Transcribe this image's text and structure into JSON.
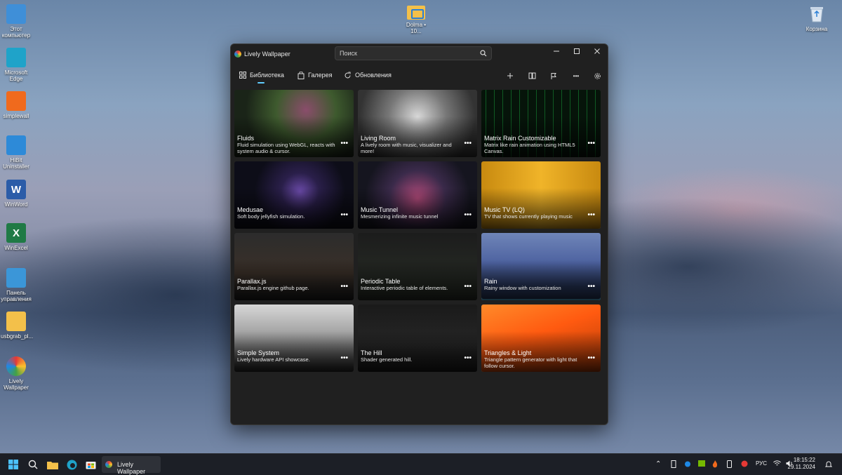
{
  "desktop": {
    "icons": [
      {
        "label": "Этот компьютер",
        "icon": "computer-icon",
        "color": "#3f8fd8"
      },
      {
        "label": "Microsoft Edge",
        "icon": "edge-icon",
        "color": "#1fa3c9"
      },
      {
        "label": "simplewall",
        "icon": "fire-icon",
        "color": "#f06a1d"
      },
      {
        "label": "HiBit Uninstaller",
        "icon": "uninstaller-icon",
        "color": "#2d8ad8"
      },
      {
        "label": "WinWord",
        "icon": "word-icon",
        "color": "#2b5ca8",
        "glyph": "W"
      },
      {
        "label": "WinExcel",
        "icon": "excel-icon",
        "color": "#1f7a45",
        "glyph": "X"
      },
      {
        "label": "Панель управления",
        "icon": "control-panel-icon",
        "color": "#3b96d8"
      },
      {
        "label": "usbgrab_pl...",
        "icon": "folder-icon",
        "color": "#f3c04a"
      },
      {
        "label": "Lively Wallpaper",
        "icon": "lively-icon",
        "color": "#e53935"
      }
    ],
    "top_folder": {
      "label": "Dolma • 10...",
      "icon": "folder-icon"
    },
    "recycle_bin": {
      "label": "Корзина",
      "icon": "recycle-bin-icon"
    }
  },
  "window": {
    "title": "Lively Wallpaper",
    "search_placeholder": "Поиск",
    "nav": [
      {
        "label": "Библиотека",
        "icon": "grid-icon",
        "active": true
      },
      {
        "label": "Галерея",
        "icon": "bag-icon"
      },
      {
        "label": "Обновления",
        "icon": "refresh-icon"
      }
    ],
    "more_glyph": "•••"
  },
  "wallpapers": [
    {
      "title": "Fluids",
      "desc": "Fluid simulation using WebGL, reacts with system audio & cursor."
    },
    {
      "title": "Living Room",
      "desc": "A lively room with music, visualizer and more!"
    },
    {
      "title": "Matrix Rain Customizable",
      "desc": "Matrix like rain animation using HTML5 Canvas."
    },
    {
      "title": "Medusae",
      "desc": "Soft body jellyfish simulation."
    },
    {
      "title": "Music Tunnel",
      "desc": "Mesmerizing infinite music tunnel"
    },
    {
      "title": "Music TV (LQ)",
      "desc": "TV that shows currently playing music"
    },
    {
      "title": "Parallax.js",
      "desc": "Parallax.js engine github page."
    },
    {
      "title": "Periodic Table",
      "desc": "Interactive periodic table of elements."
    },
    {
      "title": "Rain",
      "desc": "Rainy window with customization",
      "selected": true
    },
    {
      "title": "Simple System",
      "desc": "Lively hardware API showcase."
    },
    {
      "title": "The Hill",
      "desc": "Shader generated hill."
    },
    {
      "title": "Triangles & Light",
      "desc": "Triangle pattern generator with light that follow cursor."
    }
  ],
  "taskbar": {
    "app_label": "Lively Wallpaper",
    "language": "РУС",
    "time": "18:15:22",
    "date": "29.11.2024"
  },
  "colors": {
    "accent": "#60cdff",
    "window_bg": "#202020"
  }
}
